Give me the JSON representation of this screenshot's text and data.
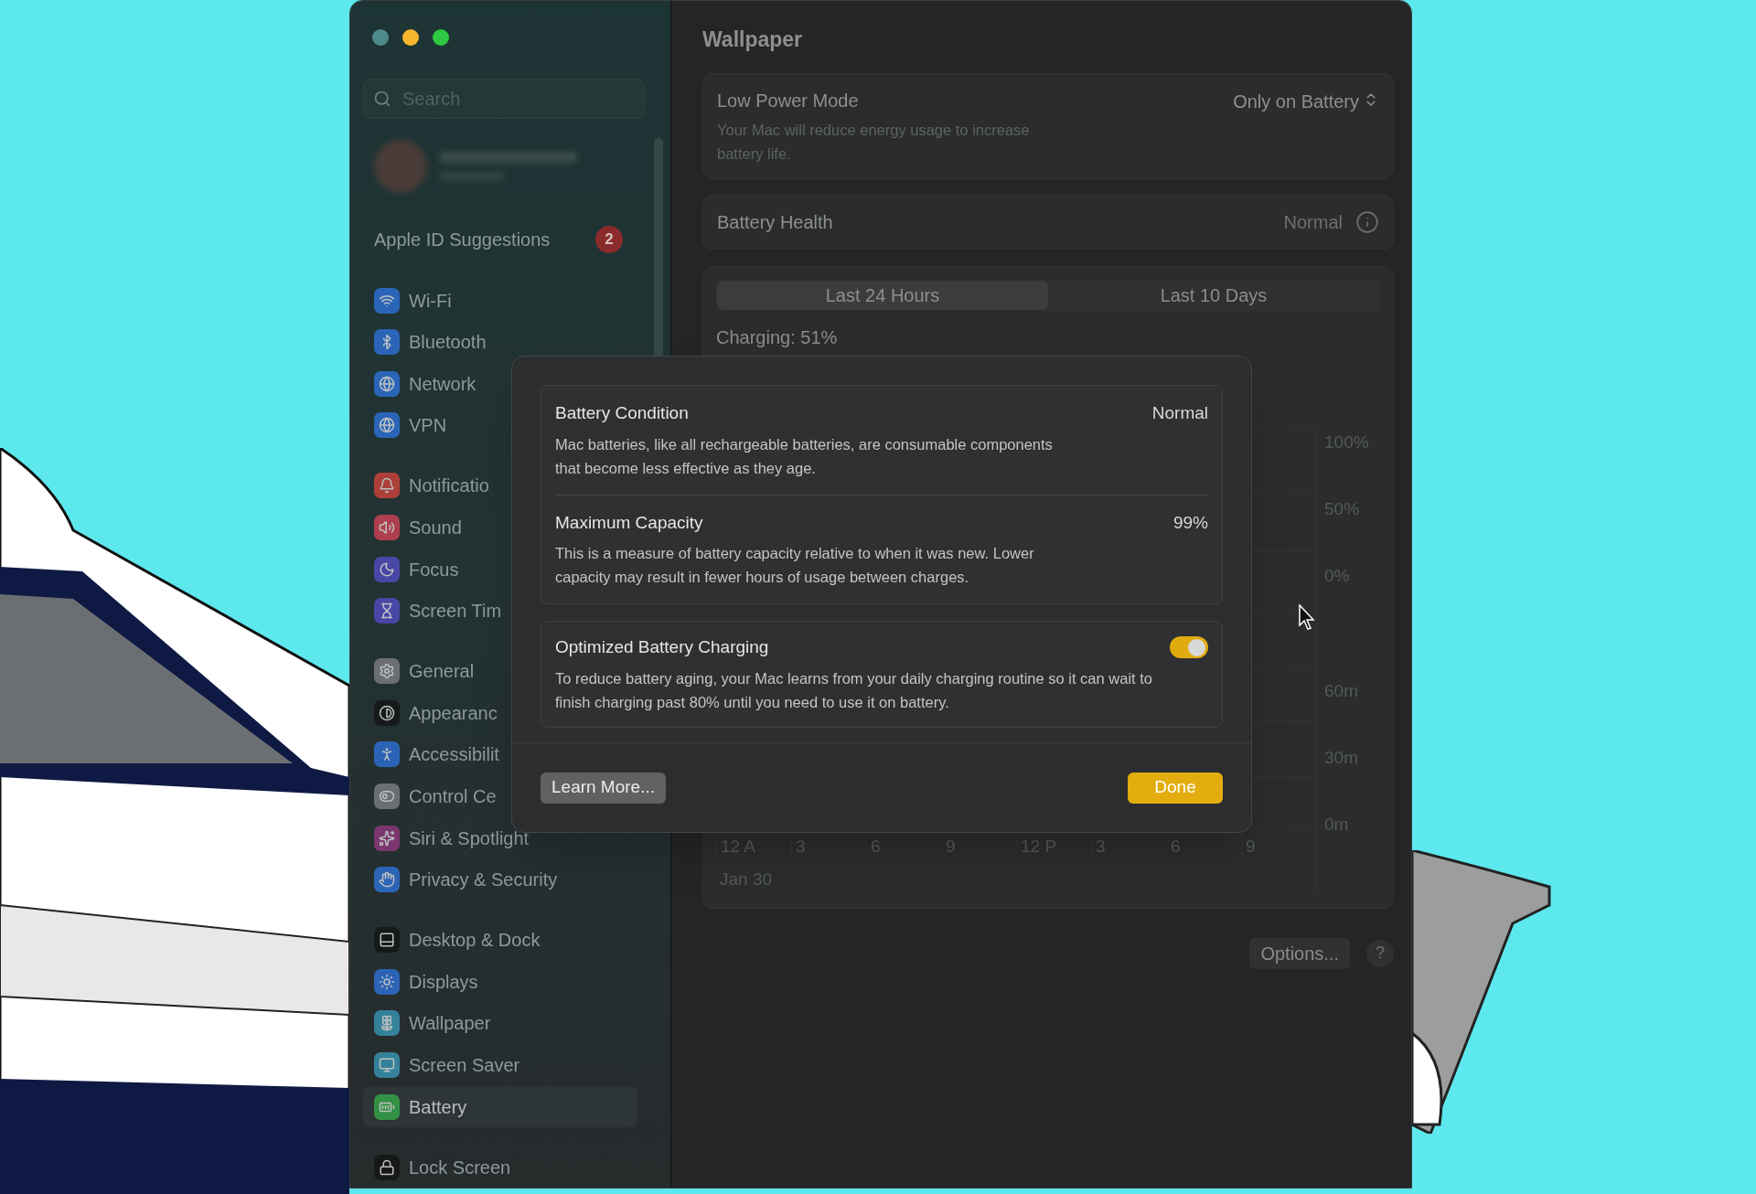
{
  "window": {
    "title": "Wallpaper"
  },
  "sidebar": {
    "search": {
      "placeholder": "Search"
    },
    "apple_id": {
      "label": "Apple ID Suggestions",
      "badge": "2"
    },
    "groups": [
      [
        {
          "label": "Wi-Fi",
          "selected": false
        },
        {
          "label": "Bluetooth",
          "selected": false
        },
        {
          "label": "Network",
          "selected": false
        },
        {
          "label": "VPN",
          "selected": false
        }
      ],
      [
        {
          "label": "Notificatio",
          "selected": false
        },
        {
          "label": "Sound",
          "selected": false
        },
        {
          "label": "Focus",
          "selected": false
        },
        {
          "label": "Screen Tim",
          "selected": false
        }
      ],
      [
        {
          "label": "General",
          "selected": false
        },
        {
          "label": "Appearanc",
          "selected": false
        },
        {
          "label": "Accessibilit",
          "selected": false
        },
        {
          "label": "Control Ce",
          "selected": false
        },
        {
          "label": "Siri & Spotlight",
          "selected": false
        },
        {
          "label": "Privacy & Security",
          "selected": false
        }
      ],
      [
        {
          "label": "Desktop & Dock",
          "selected": false
        },
        {
          "label": "Displays",
          "selected": false
        },
        {
          "label": "Wallpaper",
          "selected": false
        },
        {
          "label": "Screen Saver",
          "selected": false
        },
        {
          "label": "Battery",
          "selected": true
        }
      ],
      [
        {
          "label": "Lock Screen",
          "selected": false
        }
      ]
    ]
  },
  "low_power_mode": {
    "label": "Low Power Mode",
    "description": "Your Mac will reduce energy usage to increase battery life.",
    "value": "Only on Battery"
  },
  "battery_health": {
    "label": "Battery Health",
    "value": "Normal"
  },
  "tabs": [
    {
      "label": "Last 24 Hours",
      "selected": true
    },
    {
      "label": "Last 10 Days",
      "selected": false
    }
  ],
  "charging_label": "Charging: 51%",
  "chart_axes": {
    "level_labels": [
      "100%",
      "50%",
      "0%"
    ],
    "time_labels": [
      "60m",
      "30m",
      "0m"
    ],
    "x_labels": [
      "12 A",
      "3",
      "6",
      "9",
      "12 P",
      "3",
      "6",
      "9"
    ],
    "date": "Jan 30"
  },
  "options_button": "Options...",
  "help_button": "?",
  "dialog": {
    "sections": [
      {
        "title": "Battery Condition",
        "value": "Normal",
        "description": "Mac batteries, like all rechargeable batteries, are consumable components that become less effective as they age."
      },
      {
        "title": "Maximum Capacity",
        "value": "99%",
        "description": "This is a measure of battery capacity relative to when it was new. Lower capacity may result in fewer hours of usage between charges."
      }
    ],
    "optimized": {
      "title": "Optimized Battery Charging",
      "description": "To reduce battery aging, your Mac learns from your daily charging routine so it can wait to finish charging past 80% until you need to use it on battery.",
      "on": true
    },
    "learn_more": "Learn More...",
    "done": "Done"
  }
}
